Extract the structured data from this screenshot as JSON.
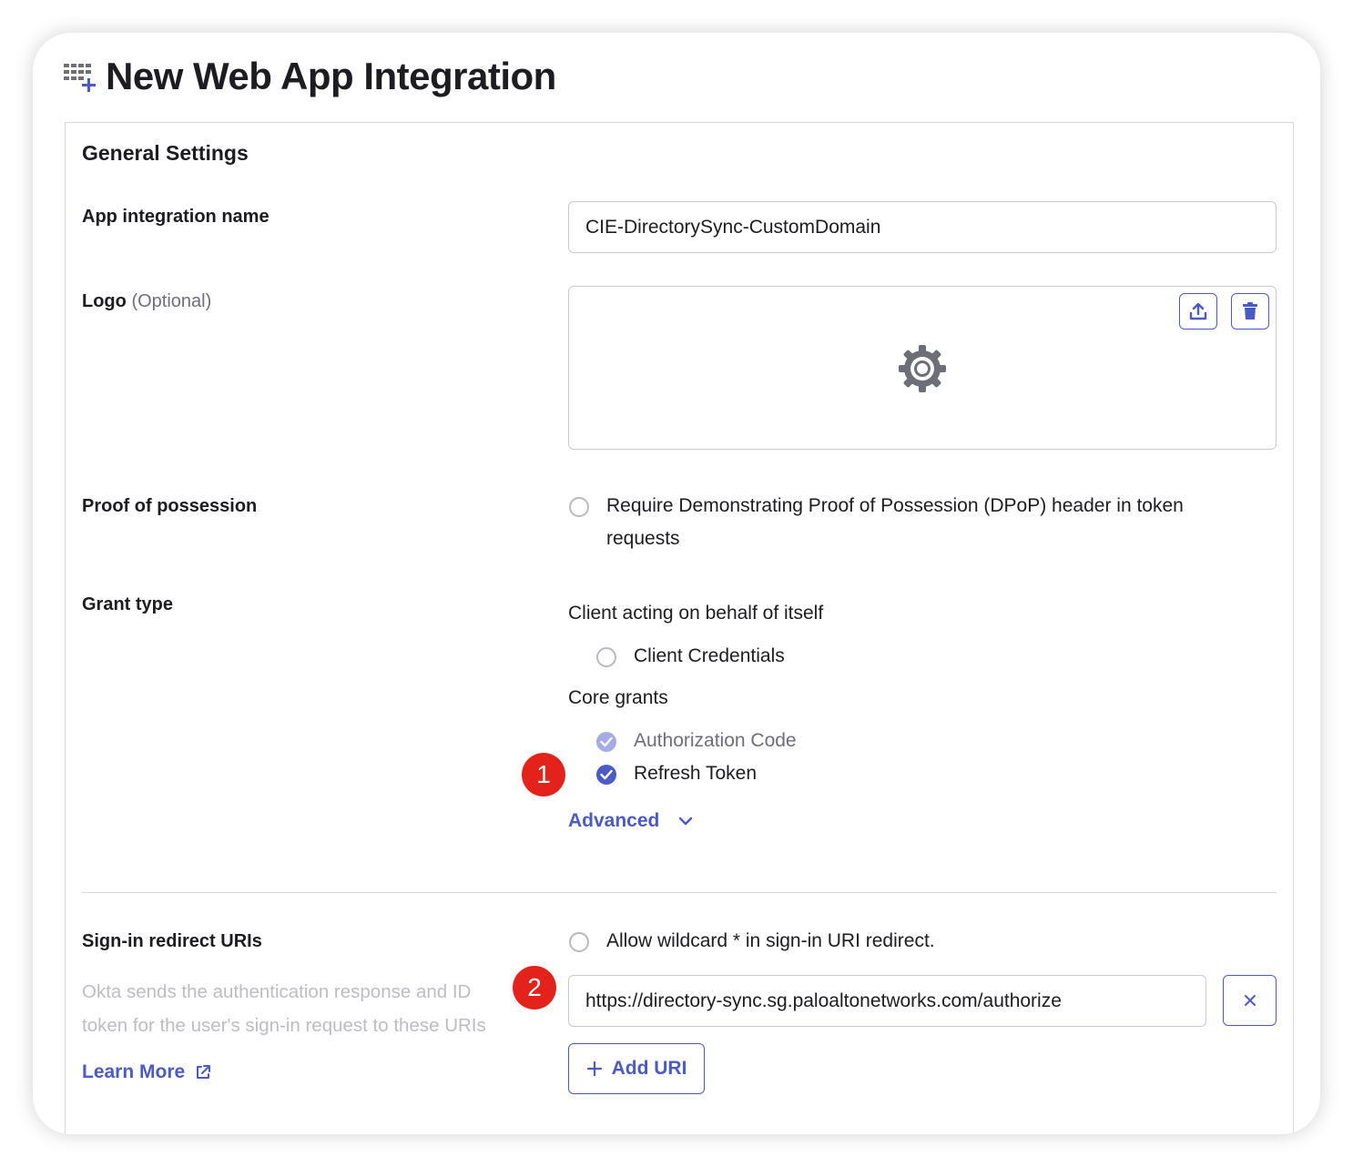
{
  "page": {
    "title": "New Web App Integration"
  },
  "general": {
    "section_title": "General Settings",
    "app_name_label": "App integration name",
    "app_name_value": "CIE-DirectorySync-CustomDomain",
    "logo_label": "Logo",
    "logo_optional": "(Optional)",
    "pop_label": "Proof of possession",
    "pop_checkbox_label_line1": "Require Demonstrating Proof of Possession (DPoP) header in token",
    "pop_checkbox_label_line2": "requests",
    "grant_label": "Grant type",
    "client_group_label": "Client acting on behalf of itself",
    "client_credentials_label": "Client Credentials",
    "core_group_label": "Core grants",
    "authorization_code_label": "Authorization Code",
    "refresh_token_label": "Refresh Token",
    "advanced_label": "Advanced"
  },
  "redirect": {
    "label": "Sign-in redirect URIs",
    "help_line1": "Okta sends the authentication response and ID",
    "help_line2": "token for the user's sign-in request to these URIs",
    "learn_more": "Learn More",
    "wildcard_label": "Allow wildcard * in sign-in URI redirect.",
    "uri_value": "https://directory-sync.sg.paloaltonetworks.com/authorize",
    "add_uri_label": "Add URI"
  },
  "annotations": {
    "badge1": "1",
    "badge2": "2"
  },
  "state": {
    "pop_checked": false,
    "client_credentials_checked": false,
    "authorization_code_checked": true,
    "authorization_code_disabled": true,
    "refresh_token_checked": true,
    "wildcard_checked": false
  },
  "icons": {
    "title_icon": "grid-plus-icon",
    "upload": "upload-icon",
    "delete": "trash-icon",
    "logo_placeholder": "gear-icon",
    "advanced_chevron": "chevron-down-icon",
    "external_link": "external-link-icon",
    "remove": "close-icon",
    "add": "plus-icon"
  },
  "colors": {
    "accent": "#4b5bc4",
    "accent_disabled": "#a5ace3",
    "badge": "#e3231b",
    "border": "#c9c9d0",
    "muted_text": "#bdbdc4"
  }
}
